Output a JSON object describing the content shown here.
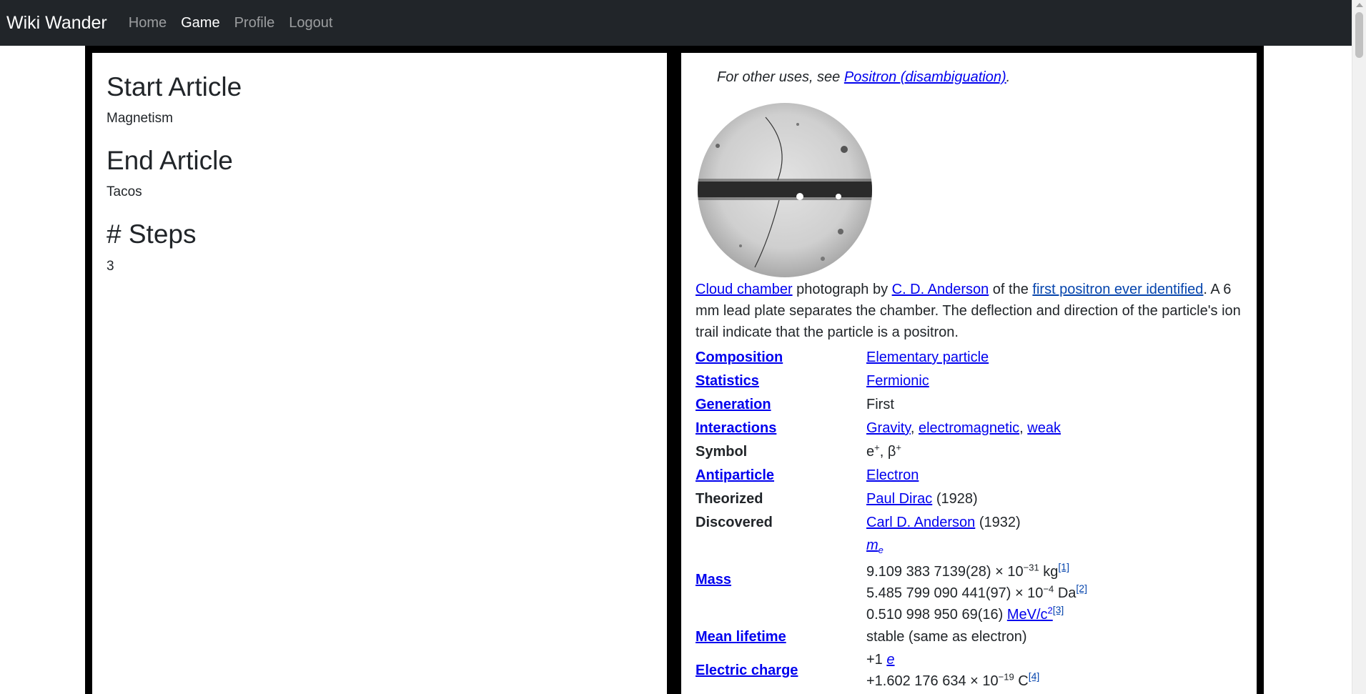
{
  "nav": {
    "brand": "Wiki Wander",
    "links": [
      "Home",
      "Game",
      "Profile",
      "Logout"
    ]
  },
  "game": {
    "start_heading": "Start Article",
    "start_value": "Magnetism",
    "end_heading": "End Article",
    "end_value": "Tacos",
    "steps_heading": "# Steps",
    "steps_value": "3"
  },
  "article": {
    "hatnote_prefix": "For other uses, see ",
    "hatnote_link": "Positron (disambiguation)",
    "hatnote_suffix": ".",
    "caption": {
      "link1": "Cloud chamber",
      "t1": " photograph by ",
      "link2": "C. D. Anderson",
      "t2": " of the ",
      "link3": "first positron ever identified",
      "t3": ". A 6 mm lead plate separates the chamber. The deflection and direction of the particle's ion trail indicate that the particle is a positron."
    },
    "infobox": {
      "composition_label": "Composition",
      "composition_value": "Elementary particle",
      "statistics_label": "Statistics",
      "statistics_value": "Fermionic",
      "generation_label": "Generation",
      "generation_value": "First",
      "interactions_label": "Interactions",
      "interactions_v1": "Gravity",
      "interactions_v2": "electromagnetic",
      "interactions_v3": "weak",
      "symbol_label": "Symbol",
      "symbol_e": "e",
      "symbol_sep": ", β",
      "symbol_plus": "+",
      "antiparticle_label": "Antiparticle",
      "antiparticle_value": "Electron",
      "theorized_label": "Theorized",
      "theorized_link": "Paul Dirac",
      "theorized_year": " (1928)",
      "discovered_label": "Discovered",
      "discovered_link": "Carl D. Anderson",
      "discovered_year": " (1932)",
      "mass_label": "Mass",
      "mass_symbol": "m",
      "mass_symbol_sub": "e",
      "mass_line1_a": "9.109 383 7139(28) × 10",
      "mass_line1_exp": "−31",
      "mass_line1_unit": " kg",
      "mass_line1_ref": "[1]",
      "mass_line2_a": "5.485 799 090 441(97) × 10",
      "mass_line2_exp": "−4",
      "mass_line2_unit": " Da",
      "mass_line2_ref": "[2]",
      "mass_line3_a": "0.510 998 950 69(16) ",
      "mass_line3_unit": "MeV/c",
      "mass_line3_exp": "2",
      "mass_line3_ref": "[3]",
      "lifetime_label": "Mean lifetime",
      "lifetime_value": "stable (same as electron)",
      "charge_label": "Electric charge",
      "charge_line1_a": "+1 ",
      "charge_line1_link": "e",
      "charge_line2_a": "+1.602 176 634 × 10",
      "charge_line2_exp": "−19",
      "charge_line2_unit": " C",
      "charge_line2_ref": "[4]"
    }
  },
  "colors": {
    "navbar_bg": "#212529",
    "link": "#0000ee",
    "ref_link": "#0645ad",
    "frame": "#000000"
  }
}
